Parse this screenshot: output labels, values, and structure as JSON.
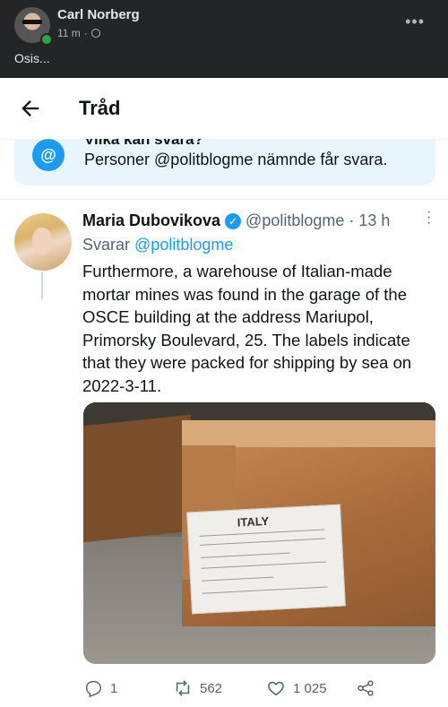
{
  "facebook": {
    "poster_name": "Carl Norberg",
    "time": "11 m",
    "meta_separator": "·",
    "post_text": "Osis...",
    "more": "•••"
  },
  "header": {
    "title": "Tråd"
  },
  "reply_restriction": {
    "heading_partial": "Vilka kan svara?",
    "text": "Personer @politblogme nämnde får svara."
  },
  "tweet": {
    "author_name": "Maria Dubovikova",
    "handle": "@politblogme",
    "separator": "·",
    "time": "13 h",
    "replying_prefix": "Svarar",
    "replying_to": "@politblogme",
    "body": "Furthermore, a warehouse of Italian-made mortar mines was found in the garage of the OSCE building at the address Mariupol, Primorsky Boulevard, 25. The labels indicate that they were packed for shipping by sea on 2022-3-11.",
    "image_label_text": "ITALY",
    "stats": {
      "replies": "1",
      "retweets": "562",
      "likes": "1 025"
    }
  },
  "colors": {
    "facebook_bg": "#242526",
    "twitter_blue": "#1d9bf0",
    "secondary_text": "#536471"
  }
}
